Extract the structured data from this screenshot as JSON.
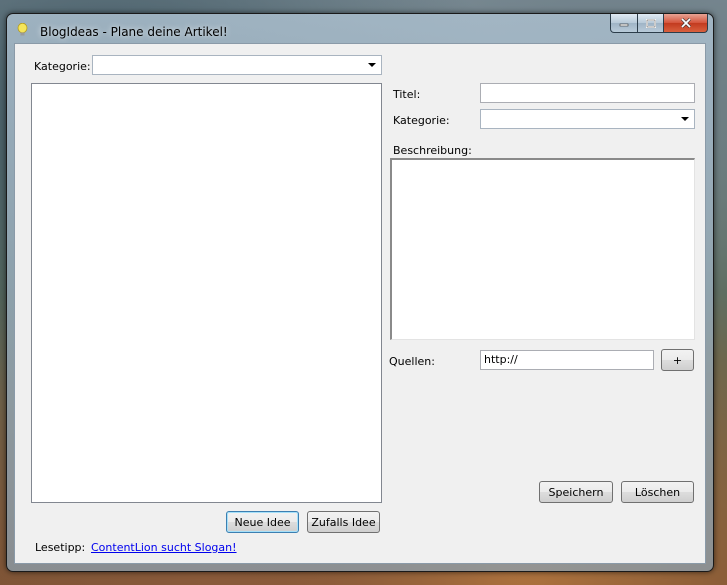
{
  "window": {
    "title": "BlogIdeas - Plane deine Artikel!"
  },
  "left": {
    "category_label": "Kategorie:",
    "category_value": "",
    "new_idea_button": "Neue Idee",
    "random_idea_button": "Zufalls Idee",
    "tip_label": "Lesetipp:",
    "tip_link": "ContentLion sucht Slogan!"
  },
  "right": {
    "title_label": "Titel:",
    "title_value": "",
    "category_label": "Kategorie:",
    "category_value": "",
    "description_label": "Beschreibung:",
    "description_value": "",
    "sources_label": "Quellen:",
    "sources_value": "http://",
    "add_source_button": "+",
    "save_button": "Speichern",
    "delete_button": "Löschen"
  }
}
